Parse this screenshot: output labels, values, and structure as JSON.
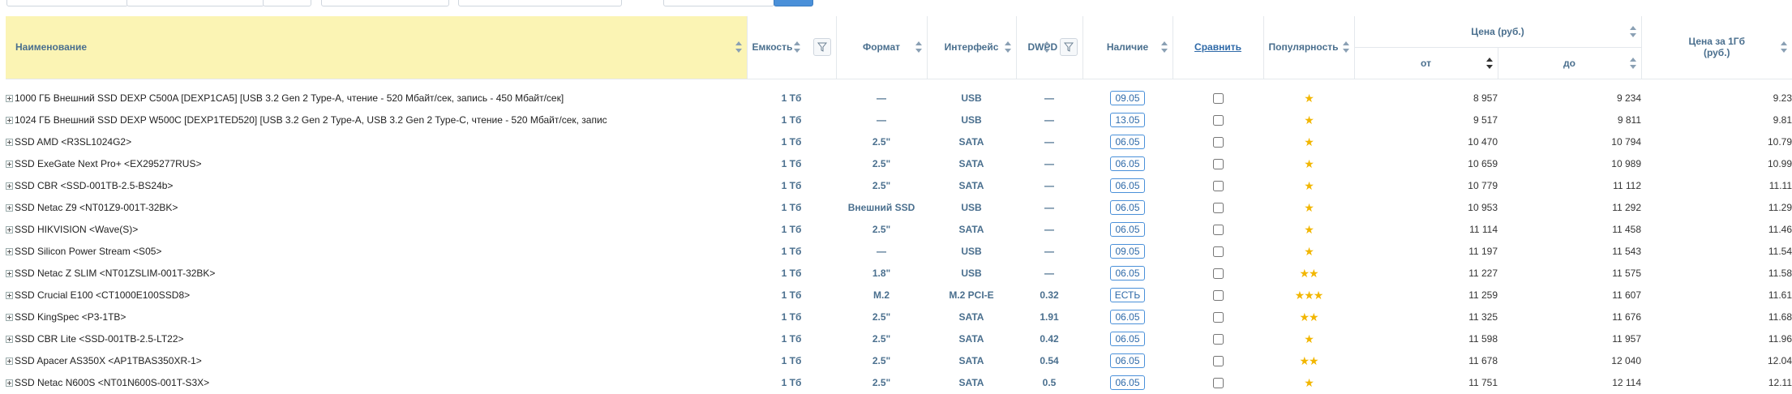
{
  "header": {
    "name": "Наименование",
    "capacity": "Емкость",
    "format": "Формат",
    "interface": "Интерфейс",
    "dwpd": "DWPD",
    "availability": "Наличие",
    "compare": "Сравнить",
    "popularity": "Популярность",
    "price": "Цена (руб.)",
    "price_from": "от",
    "price_to": "до",
    "price_per_gb": "Цена за 1Гб (руб.)"
  },
  "icons": {
    "expand": "plus-square-icon",
    "sort": "sort-arrows-icon",
    "filter": "funnel-icon",
    "star": "star-icon"
  },
  "colors": {
    "name_header_bg": "#fbf4b4",
    "header_text": "#4a6f8e",
    "availability_border": "#4a90d9",
    "star": "#f2b600"
  },
  "rows": [
    {
      "name": "1000 ГБ Внешний SSD DEXP C500A [DEXP1CA5] [USB 3.2 Gen 2 Type-A, чтение - 520 Мбайт/сек, запись - 450 Мбайт/сек]",
      "capacity": "1 Тб",
      "format": "—",
      "interface": "USB",
      "dwpd": "—",
      "availability": "09.05",
      "stars": "★",
      "price_from": "8 957",
      "price_to": "9 234",
      "price_per_gb": "9.23"
    },
    {
      "name": "1024 ГБ Внешний SSD DEXP W500C [DEXP1TED520] [USB 3.2 Gen 2 Type-A, USB 3.2 Gen 2 Type-C, чтение - 520 Мбайт/сек, запис",
      "capacity": "1 Тб",
      "format": "—",
      "interface": "USB",
      "dwpd": "—",
      "availability": "13.05",
      "stars": "★",
      "price_from": "9 517",
      "price_to": "9 811",
      "price_per_gb": "9.81"
    },
    {
      "name": "SSD AMD <R3SL1024G2>",
      "capacity": "1 Тб",
      "format": "2.5\"",
      "interface": "SATA",
      "dwpd": "—",
      "availability": "06.05",
      "stars": "★",
      "price_from": "10 470",
      "price_to": "10 794",
      "price_per_gb": "10.79"
    },
    {
      "name": "SSD ExeGate Next Pro+ <EX295277RUS>",
      "capacity": "1 Тб",
      "format": "2.5\"",
      "interface": "SATA",
      "dwpd": "—",
      "availability": "06.05",
      "stars": "★",
      "price_from": "10 659",
      "price_to": "10 989",
      "price_per_gb": "10.99"
    },
    {
      "name": "SSD CBR <SSD-001TB-2.5-BS24b>",
      "capacity": "1 Тб",
      "format": "2.5\"",
      "interface": "SATA",
      "dwpd": "—",
      "availability": "06.05",
      "stars": "★",
      "price_from": "10 779",
      "price_to": "11 112",
      "price_per_gb": "11.11"
    },
    {
      "name": "SSD Netac Z9 <NT01Z9-001T-32BK>",
      "capacity": "1 Тб",
      "format": "Внешний SSD",
      "interface": "USB",
      "dwpd": "—",
      "availability": "06.05",
      "stars": "★",
      "price_from": "10 953",
      "price_to": "11 292",
      "price_per_gb": "11.29"
    },
    {
      "name": "SSD HIKVISION <Wave(S)>",
      "capacity": "1 Тб",
      "format": "2.5\"",
      "interface": "SATA",
      "dwpd": "—",
      "availability": "06.05",
      "stars": "★",
      "price_from": "11 114",
      "price_to": "11 458",
      "price_per_gb": "11.46"
    },
    {
      "name": "SSD Silicon Power Stream <S05>",
      "capacity": "1 Тб",
      "format": "—",
      "interface": "USB",
      "dwpd": "—",
      "availability": "09.05",
      "stars": "★",
      "price_from": "11 197",
      "price_to": "11 543",
      "price_per_gb": "11.54"
    },
    {
      "name": "SSD Netac Z SLIM <NT01ZSLIM-001T-32BK>",
      "capacity": "1 Тб",
      "format": "1.8\"",
      "interface": "USB",
      "dwpd": "—",
      "availability": "06.05",
      "stars": "★★",
      "price_from": "11 227",
      "price_to": "11 575",
      "price_per_gb": "11.58"
    },
    {
      "name": "SSD Crucial E100 <CT1000E100SSD8>",
      "capacity": "1 Тб",
      "format": "M.2",
      "interface": "M.2 PCI-E",
      "dwpd": "0.32",
      "availability": "ЕСТЬ",
      "stars": "★★★",
      "price_from": "11 259",
      "price_to": "11 607",
      "price_per_gb": "11.61"
    },
    {
      "name": "SSD KingSpec <P3-1TB>",
      "capacity": "1 Тб",
      "format": "2.5\"",
      "interface": "SATA",
      "dwpd": "1.91",
      "availability": "06.05",
      "stars": "★★",
      "price_from": "11 325",
      "price_to": "11 676",
      "price_per_gb": "11.68"
    },
    {
      "name": "SSD CBR Lite <SSD-001TB-2.5-LT22>",
      "capacity": "1 Тб",
      "format": "2.5\"",
      "interface": "SATA",
      "dwpd": "0.42",
      "availability": "06.05",
      "stars": "★",
      "price_from": "11 598",
      "price_to": "11 957",
      "price_per_gb": "11.96"
    },
    {
      "name": "SSD Apacer AS350X <AP1TBAS350XR-1>",
      "capacity": "1 Тб",
      "format": "2.5\"",
      "interface": "SATA",
      "dwpd": "0.54",
      "availability": "06.05",
      "stars": "★★",
      "price_from": "11 678",
      "price_to": "12 040",
      "price_per_gb": "12.04"
    },
    {
      "name": "SSD Netac N600S <NT01N600S-001T-S3X>",
      "capacity": "1 Тб",
      "format": "2.5\"",
      "interface": "SATA",
      "dwpd": "0.5",
      "availability": "06.05",
      "stars": "★",
      "price_from": "11 751",
      "price_to": "12 114",
      "price_per_gb": "12.11"
    }
  ]
}
